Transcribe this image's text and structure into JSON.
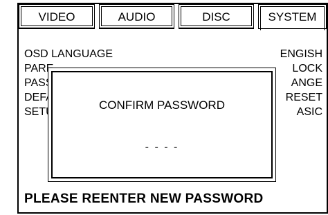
{
  "tabs": [
    {
      "label": "VIDEO"
    },
    {
      "label": "AUDIO"
    },
    {
      "label": "DISC"
    },
    {
      "label": "SYSTEM"
    }
  ],
  "settings": [
    {
      "label": "OSD LANGUAGE",
      "value": "ENGISH"
    },
    {
      "label": "PARE",
      "value": "LOCK"
    },
    {
      "label": "PASS",
      "value": "ANGE"
    },
    {
      "label": "DEFA",
      "value": "RESET"
    },
    {
      "label": "SETU",
      "value": "ASIC"
    }
  ],
  "dialog": {
    "title": "CONFIRM PASSWORD",
    "input_value": "- - - -"
  },
  "footer": {
    "message": "PLEASE REENTER NEW PASSWORD"
  }
}
